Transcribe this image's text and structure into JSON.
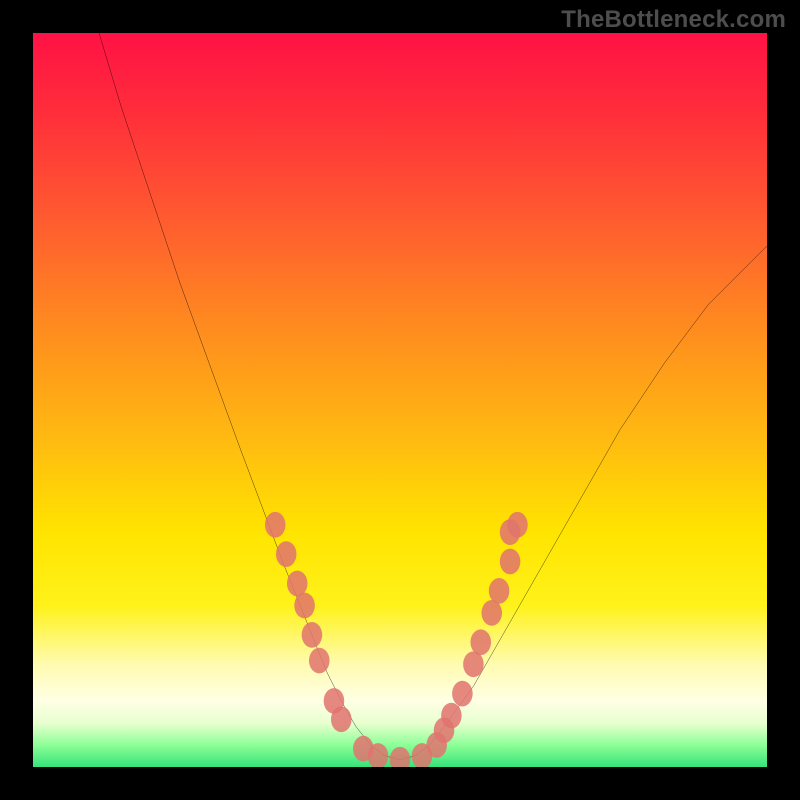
{
  "watermark": "TheBottleneck.com",
  "chart_data": {
    "type": "line",
    "title": "",
    "xlabel": "",
    "ylabel": "",
    "xlim": [
      0,
      100
    ],
    "ylim": [
      0,
      100
    ],
    "grid": false,
    "legend": false,
    "series": [
      {
        "name": "curve",
        "color": "#000000",
        "x": [
          9,
          12,
          16,
          20,
          24,
          28,
          31,
          34,
          36,
          38,
          40,
          42,
          44,
          46,
          48,
          50,
          52,
          54,
          56,
          60,
          64,
          68,
          72,
          76,
          80,
          86,
          92,
          98,
          100
        ],
        "y": [
          100,
          90,
          78,
          66,
          55,
          44,
          36,
          28,
          23,
          18,
          13,
          9,
          5.5,
          3,
          1.5,
          1,
          1.5,
          3,
          5.5,
          11,
          18,
          25,
          32,
          39,
          46,
          55,
          63,
          69,
          71
        ]
      }
    ],
    "markers": [
      {
        "name": "dots",
        "color": "#e0736f",
        "radius_pct": 1.4,
        "points": [
          [
            33,
            33
          ],
          [
            34.5,
            29
          ],
          [
            36,
            25
          ],
          [
            37,
            22
          ],
          [
            38,
            18
          ],
          [
            39,
            14.5
          ],
          [
            41,
            9
          ],
          [
            42,
            6.5
          ],
          [
            45,
            2.5
          ],
          [
            47,
            1.5
          ],
          [
            50,
            1
          ],
          [
            53,
            1.5
          ],
          [
            55,
            3
          ],
          [
            56,
            5
          ],
          [
            57,
            7
          ],
          [
            58.5,
            10
          ],
          [
            60,
            14
          ],
          [
            61,
            17
          ],
          [
            62.5,
            21
          ],
          [
            63.5,
            24
          ],
          [
            65,
            28
          ],
          [
            65,
            32
          ],
          [
            66,
            33
          ]
        ]
      }
    ],
    "background_gradient": {
      "type": "vertical",
      "stops": [
        {
          "pos": 0.0,
          "color": "#ff1245"
        },
        {
          "pos": 0.25,
          "color": "#ff5a30"
        },
        {
          "pos": 0.55,
          "color": "#ffb911"
        },
        {
          "pos": 0.78,
          "color": "#fff21a"
        },
        {
          "pos": 0.92,
          "color": "#ffffe0"
        },
        {
          "pos": 1.0,
          "color": "#35e37a"
        }
      ]
    }
  }
}
